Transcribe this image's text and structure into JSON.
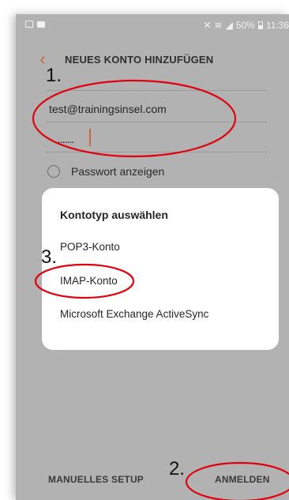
{
  "status_bar": {
    "battery_percent": "50%",
    "time": "11:36",
    "left_icons": [
      "gallery-icon",
      "folder-icon"
    ],
    "right_icons": [
      "mute-icon",
      "wifi-icon",
      "signal-icon",
      "battery-icon"
    ]
  },
  "app_bar": {
    "back_icon": "chevron-left-icon",
    "title": "NEUES KONTO HINZUFÜGEN"
  },
  "form": {
    "email_value": "test@trainingsinsel.com",
    "password_value": "........",
    "show_password_label": "Passwort anzeigen",
    "show_password_checked": false
  },
  "dialog": {
    "title": "Kontotyp auswählen",
    "options": [
      "POP3-Konto",
      "IMAP-Konto",
      "Microsoft Exchange ActiveSync"
    ]
  },
  "bottom_bar": {
    "manual_setup_label": "MANUELLES SETUP",
    "sign_in_label": "ANMELDEN"
  },
  "annotations": {
    "step1": "1.",
    "step2": "2.",
    "step3": "3.",
    "circle_color": "#e1000f"
  },
  "colors": {
    "accent": "#c46a3a",
    "overlay_background": "#b2b2b2",
    "dialog_background": "#ffffff"
  }
}
